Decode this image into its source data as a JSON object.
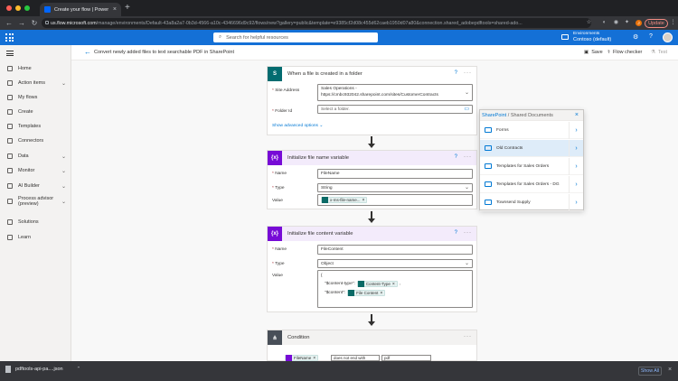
{
  "browser": {
    "tab_title": "Create your flow | Power Autom",
    "url_host": "us.flow.microsoft.com",
    "url_path": "/manage/environments/Default-43a8a2a7-0b3d-4566-a10c-4346696d9c92/flows/new?gallery=public&template=e9385cf2d08c455d62caeb1950d07a80&connection.shared_adobepdftools=shared-ado...",
    "update_label": "Update",
    "profile_initial": "J"
  },
  "header": {
    "search_placeholder": "Search for helpful resources",
    "env_label": "Environments",
    "env_name": "Contoso (default)"
  },
  "sidebar": {
    "items": [
      {
        "label": "Home",
        "icon": "home-icon",
        "chevron": false
      },
      {
        "label": "Action items",
        "icon": "checklist-icon",
        "chevron": true
      },
      {
        "label": "My flows",
        "icon": "flow-icon",
        "chevron": false
      },
      {
        "label": "Create",
        "icon": "plus-icon",
        "chevron": false
      },
      {
        "label": "Templates",
        "icon": "template-icon",
        "chevron": false
      },
      {
        "label": "Connectors",
        "icon": "connector-icon",
        "chevron": false
      },
      {
        "label": "Data",
        "icon": "database-icon",
        "chevron": true
      },
      {
        "label": "Monitor",
        "icon": "monitor-icon",
        "chevron": true
      },
      {
        "label": "AI Builder",
        "icon": "ai-icon",
        "chevron": true
      },
      {
        "label": "Process advisor (preview)",
        "icon": "process-icon",
        "chevron": true
      },
      {
        "label": "Solutions",
        "icon": "solutions-icon",
        "chevron": false
      },
      {
        "label": "Learn",
        "icon": "book-icon",
        "chevron": false
      }
    ]
  },
  "commandbar": {
    "title": "Convert newly added files to text searchable PDF in SharePoint",
    "save": "Save",
    "checker": "Flow checker",
    "test": "Test"
  },
  "trigger": {
    "title": "When a file is created in a folder",
    "site_label": "Site Address",
    "site_value_1": "Sales Operations -",
    "site_value_2": "https://cmbc932042.sharepoint.com/sites/CustomerContracts",
    "folder_label": "Folder Id",
    "folder_placeholder": "Select a folder.",
    "advanced": "Show advanced options"
  },
  "var1": {
    "title": "Initialize file name variable",
    "name_label": "Name",
    "name_value": "FileName",
    "type_label": "Type",
    "type_value": "String",
    "value_label": "Value",
    "chip": "x-ms-file-name..."
  },
  "var2": {
    "title": "Initialize file content variable",
    "name_label": "Name",
    "name_value": "FileContent",
    "type_label": "Type",
    "type_value": "Object",
    "value_label": "Value",
    "line1": "{",
    "line2_key": "\"$content-type\":",
    "chip1": "Content-Type",
    "line3_key": "\"$content\":",
    "chip2": "File Content"
  },
  "condition": {
    "title": "Condition",
    "chip": "FileName",
    "operator": "does not end with",
    "value": "pdf"
  },
  "flyout": {
    "root": "SharePoint",
    "path": "Shared Documents",
    "items": [
      "Forms",
      "Old Contracts",
      "Templates for Sales Orders",
      "Templates for Sales Orders - DG",
      "Townsend Supply"
    ]
  },
  "download": {
    "file": "pdftools-api-pa....json",
    "show_all": "Show All"
  },
  "colors": {
    "brand": "#1470d6",
    "sharepoint": "#036c70",
    "variable": "#770bd6",
    "condition": "#484f58"
  }
}
